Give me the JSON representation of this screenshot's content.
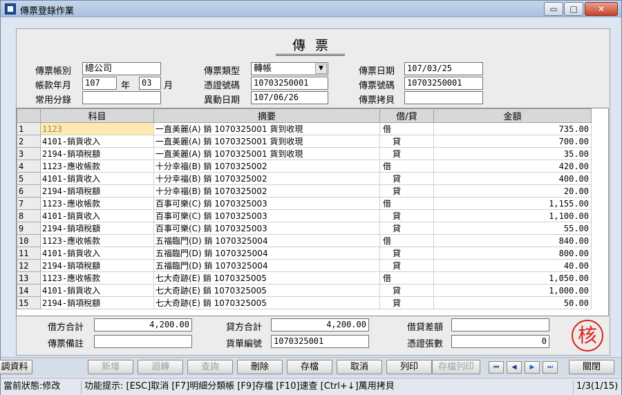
{
  "window": {
    "title": "傳票登錄作業",
    "btn_min": "▭",
    "btn_max": "□",
    "btn_close": "✕"
  },
  "heading": "傳票",
  "form": {
    "ledger_label": "傳票帳別",
    "ledger_value": "總公司",
    "period_label": "帳款年月",
    "period_year": "107",
    "year_label": "年",
    "period_month": "03",
    "month_label": "月",
    "common_entry_label": "常用分錄",
    "common_entry_value": "",
    "type_label": "傳票類型",
    "type_value": "轉帳",
    "voucher_label": "憑證號碼",
    "voucher_value": "10703250001",
    "change_date_label": "異動日期",
    "change_date_value": "107/06/26",
    "date_label": "傳票日期",
    "date_value": "107/03/25",
    "number_label": "傳票號碼",
    "number_value": "10703250001",
    "copy_label": "傳票拷貝",
    "copy_value": ""
  },
  "grid": {
    "headers": {
      "rownum": "",
      "account": "科目",
      "summary": "摘要",
      "dc": "借/貸",
      "amount": "金額"
    },
    "rows": [
      {
        "n": "1",
        "account": "1123",
        "summary": "一直美麗(A) 銷 1070325001  貨到收現",
        "dc": "借",
        "amount": "735.00"
      },
      {
        "n": "2",
        "account": "4101-銷貨收入",
        "summary": "一直美麗(A) 銷 1070325001  貨到收現",
        "dc": "貸",
        "amount": "700.00"
      },
      {
        "n": "3",
        "account": "2194-銷項稅額",
        "summary": "一直美麗(A) 銷 1070325001  貨到收現",
        "dc": "貸",
        "amount": "35.00"
      },
      {
        "n": "4",
        "account": "1123-應收帳款",
        "summary": "十分幸福(B) 銷 1070325002",
        "dc": "借",
        "amount": "420.00"
      },
      {
        "n": "5",
        "account": "4101-銷貨收入",
        "summary": "十分幸福(B) 銷 1070325002",
        "dc": "貸",
        "amount": "400.00"
      },
      {
        "n": "6",
        "account": "2194-銷項稅額",
        "summary": "十分幸福(B) 銷 1070325002",
        "dc": "貸",
        "amount": "20.00"
      },
      {
        "n": "7",
        "account": "1123-應收帳款",
        "summary": "百事可樂(C) 銷 1070325003",
        "dc": "借",
        "amount": "1,155.00"
      },
      {
        "n": "8",
        "account": "4101-銷貨收入",
        "summary": "百事可樂(C) 銷 1070325003",
        "dc": "貸",
        "amount": "1,100.00"
      },
      {
        "n": "9",
        "account": "2194-銷項稅額",
        "summary": "百事可樂(C) 銷 1070325003",
        "dc": "貸",
        "amount": "55.00"
      },
      {
        "n": "10",
        "account": "1123-應收帳款",
        "summary": "五福臨門(D) 銷 1070325004",
        "dc": "借",
        "amount": "840.00"
      },
      {
        "n": "11",
        "account": "4101-銷貨收入",
        "summary": "五福臨門(D) 銷 1070325004",
        "dc": "貸",
        "amount": "800.00"
      },
      {
        "n": "12",
        "account": "2194-銷項稅額",
        "summary": "五福臨門(D) 銷 1070325004",
        "dc": "貸",
        "amount": "40.00"
      },
      {
        "n": "13",
        "account": "1123-應收帳款",
        "summary": "七大奇跡(E) 銷 1070325005",
        "dc": "借",
        "amount": "1,050.00"
      },
      {
        "n": "14",
        "account": "4101-銷貨收入",
        "summary": "七大奇跡(E) 銷 1070325005",
        "dc": "貸",
        "amount": "1,000.00"
      },
      {
        "n": "15",
        "account": "2194-銷項稅額",
        "summary": "七大奇跡(E) 銷 1070325005",
        "dc": "貸",
        "amount": "50.00"
      }
    ]
  },
  "totals": {
    "debit_label": "借方合計",
    "debit_value": "4,200.00",
    "credit_label": "貸方合計",
    "credit_value": "4,200.00",
    "diff_label": "借貸差額",
    "diff_value": "",
    "remark_label": "傳票備註",
    "remark_value": "",
    "bill_label": "貨單編號",
    "bill_value": "1070325001",
    "count_label": "憑證張數",
    "count_value": "0"
  },
  "stamp": "核",
  "toolbar": {
    "data_btn": "調資料",
    "add": "新增",
    "reverse": "迴轉",
    "query": "查詢",
    "delete": "刪除",
    "save": "存檔",
    "cancel": "取消",
    "print": "列印",
    "save_print": "存檔列印",
    "nav_first": "⏮",
    "nav_prev": "◀",
    "nav_next": "▶",
    "nav_last": "⏭",
    "close": "關閉"
  },
  "status": {
    "state": "當前狀態:修改",
    "hint": "功能提示: [ESC]取消 [F7]明細分類帳 [F9]存檔 [F10]速查 [Ctrl+↓]萬用拷貝",
    "page": "1/3(1/15)"
  }
}
